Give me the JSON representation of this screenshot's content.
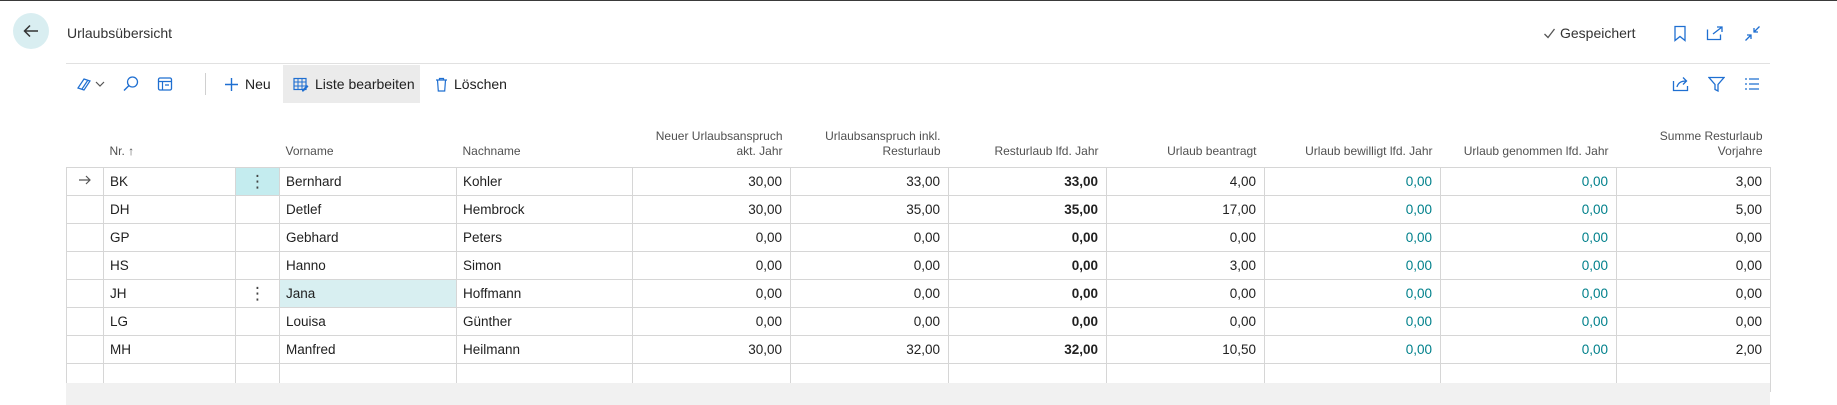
{
  "header": {
    "title": "Urlaubsübersicht",
    "saved_label": "Gespeichert"
  },
  "actionbar": {
    "new_label": "Neu",
    "edit_list_label": "Liste bearbeiten",
    "delete_label": "Löschen"
  },
  "columns": [
    {
      "key": "nr",
      "label": "Nr. ↑"
    },
    {
      "key": "vorname",
      "label": "Vorname"
    },
    {
      "key": "nachname",
      "label": "Nachname"
    },
    {
      "key": "neu",
      "label": "Neuer Urlaubsanspruch akt. Jahr"
    },
    {
      "key": "inkl",
      "label": "Urlaubsanspruch inkl. Resturlaub"
    },
    {
      "key": "rest",
      "label": "Resturlaub lfd. Jahr"
    },
    {
      "key": "beantragt",
      "label": "Urlaub beantragt"
    },
    {
      "key": "bewilligt",
      "label": "Urlaub bewilligt lfd. Jahr"
    },
    {
      "key": "genommen",
      "label": "Urlaub genommen lfd. Jahr"
    },
    {
      "key": "summe",
      "label": "Summe Resturlaub Vorjahre"
    }
  ],
  "rows": [
    {
      "nr": "BK",
      "vorname": "Bernhard",
      "nachname": "Kohler",
      "neu": "30,00",
      "inkl": "33,00",
      "rest": "33,00",
      "beantragt": "4,00",
      "bewilligt": "0,00",
      "genommen": "0,00",
      "summe": "3,00"
    },
    {
      "nr": "DH",
      "vorname": "Detlef",
      "nachname": "Hembrock",
      "neu": "30,00",
      "inkl": "35,00",
      "rest": "35,00",
      "beantragt": "17,00",
      "bewilligt": "0,00",
      "genommen": "0,00",
      "summe": "5,00"
    },
    {
      "nr": "GP",
      "vorname": "Gebhard",
      "nachname": "Peters",
      "neu": "0,00",
      "inkl": "0,00",
      "rest": "0,00",
      "beantragt": "0,00",
      "bewilligt": "0,00",
      "genommen": "0,00",
      "summe": "0,00"
    },
    {
      "nr": "HS",
      "vorname": "Hanno",
      "nachname": "Simon",
      "neu": "0,00",
      "inkl": "0,00",
      "rest": "0,00",
      "beantragt": "3,00",
      "bewilligt": "0,00",
      "genommen": "0,00",
      "summe": "0,00"
    },
    {
      "nr": "JH",
      "vorname": "Jana",
      "nachname": "Hoffmann",
      "neu": "0,00",
      "inkl": "0,00",
      "rest": "0,00",
      "beantragt": "0,00",
      "bewilligt": "0,00",
      "genommen": "0,00",
      "summe": "0,00"
    },
    {
      "nr": "LG",
      "vorname": "Louisa",
      "nachname": "Günther",
      "neu": "0,00",
      "inkl": "0,00",
      "rest": "0,00",
      "beantragt": "0,00",
      "bewilligt": "0,00",
      "genommen": "0,00",
      "summe": "0,00"
    },
    {
      "nr": "MH",
      "vorname": "Manfred",
      "nachname": "Heilmann",
      "neu": "30,00",
      "inkl": "32,00",
      "rest": "32,00",
      "beantragt": "10,50",
      "bewilligt": "0,00",
      "genommen": "0,00",
      "summe": "2,00"
    }
  ],
  "icons": {
    "back": "arrow-left-icon",
    "saved": "checkmark-icon",
    "bookmark": "bookmark-icon",
    "open_new": "open-in-new-window-icon",
    "collapse": "collapse-icon",
    "views": "views-icon",
    "search": "search-icon",
    "layout": "layout-icon",
    "share": "share-icon",
    "filter": "filter-icon",
    "list": "list-icon"
  },
  "colors": {
    "accent": "#00808b",
    "selection": "#d8eff1",
    "back_button": "#d9eef1"
  }
}
